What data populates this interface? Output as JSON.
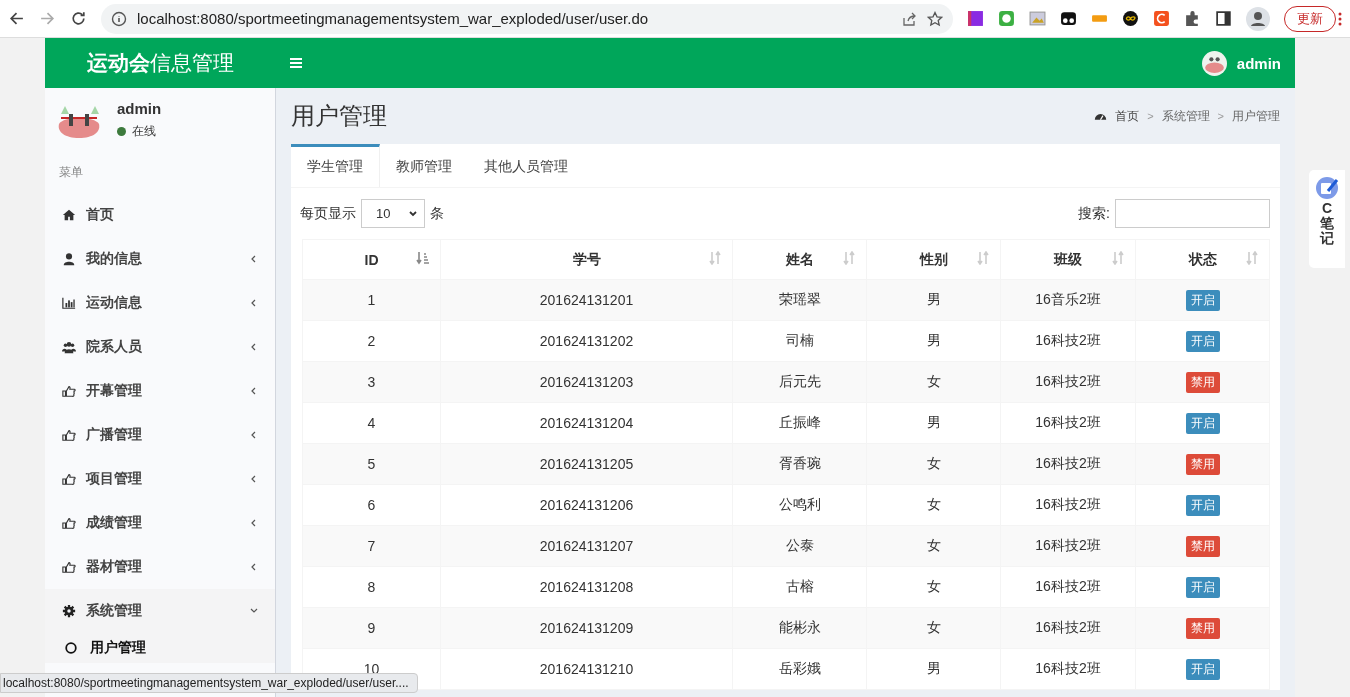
{
  "browser": {
    "url": "localhost:8080/sportmeetingmanagementsystem_war_exploded/user/user.do",
    "update_button": "更新",
    "status_url": "localhost:8080/sportmeetingmanagementsystem_war_exploded/user/user...."
  },
  "header": {
    "logo_bold": "运动会",
    "logo_rest": "信息管理",
    "user": "admin"
  },
  "sidebar": {
    "user": "admin",
    "status": "在线",
    "online": true,
    "menu_label": "菜单",
    "items": [
      {
        "label": "首页",
        "kind": "home",
        "has_children": false
      },
      {
        "label": "我的信息",
        "kind": "user",
        "has_children": true,
        "expanded": false
      },
      {
        "label": "运动信息",
        "kind": "chart",
        "has_children": true,
        "expanded": false
      },
      {
        "label": "院系人员",
        "kind": "users",
        "has_children": true,
        "expanded": false
      },
      {
        "label": "开幕管理",
        "kind": "hand",
        "has_children": true,
        "expanded": false
      },
      {
        "label": "广播管理",
        "kind": "hand",
        "has_children": true,
        "expanded": false
      },
      {
        "label": "项目管理",
        "kind": "hand",
        "has_children": true,
        "expanded": false
      },
      {
        "label": "成绩管理",
        "kind": "hand",
        "has_children": true,
        "expanded": false
      },
      {
        "label": "器材管理",
        "kind": "hand",
        "has_children": true,
        "expanded": false
      },
      {
        "label": "系统管理",
        "kind": "gear",
        "has_children": true,
        "expanded": true,
        "children": [
          {
            "label": "用户管理",
            "selected": true
          }
        ]
      }
    ]
  },
  "page": {
    "title": "用户管理",
    "breadcrumb": [
      "首页",
      "系统管理",
      "用户管理"
    ],
    "breadcrumb_separator": ">"
  },
  "tabs": [
    {
      "label": "学生管理",
      "selected": true
    },
    {
      "label": "教师管理",
      "selected": false
    },
    {
      "label": "其他人员管理",
      "selected": false
    }
  ],
  "length_control": {
    "before": "每页显示",
    "value": "10",
    "after": "条"
  },
  "search": {
    "label": "搜索:"
  },
  "table": {
    "columns": [
      {
        "label": "ID",
        "sorted": true
      },
      {
        "label": "学号",
        "sorted": false
      },
      {
        "label": "姓名",
        "sorted": false
      },
      {
        "label": "性别",
        "sorted": false
      },
      {
        "label": "班级",
        "sorted": false
      },
      {
        "label": "状态",
        "sorted": false
      }
    ],
    "rows": [
      {
        "id": "1",
        "number": "201624131201",
        "name": "荣瑶翠",
        "gender": "男",
        "class": "16音乐2班",
        "status": "开启",
        "kind": "enabled"
      },
      {
        "id": "2",
        "number": "201624131202",
        "name": "司楠",
        "gender": "男",
        "class": "16科技2班",
        "status": "开启",
        "kind": "enabled"
      },
      {
        "id": "3",
        "number": "201624131203",
        "name": "后元先",
        "gender": "女",
        "class": "16科技2班",
        "status": "禁用",
        "kind": "disabled"
      },
      {
        "id": "4",
        "number": "201624131204",
        "name": "丘振峰",
        "gender": "男",
        "class": "16科技2班",
        "status": "开启",
        "kind": "enabled"
      },
      {
        "id": "5",
        "number": "201624131205",
        "name": "胥香琬",
        "gender": "女",
        "class": "16科技2班",
        "status": "禁用",
        "kind": "disabled"
      },
      {
        "id": "6",
        "number": "201624131206",
        "name": "公鸣利",
        "gender": "女",
        "class": "16科技2班",
        "status": "开启",
        "kind": "enabled"
      },
      {
        "id": "7",
        "number": "201624131207",
        "name": "公泰",
        "gender": "女",
        "class": "16科技2班",
        "status": "禁用",
        "kind": "disabled"
      },
      {
        "id": "8",
        "number": "201624131208",
        "name": "古榕",
        "gender": "女",
        "class": "16科技2班",
        "status": "开启",
        "kind": "enabled"
      },
      {
        "id": "9",
        "number": "201624131209",
        "name": "能彬永",
        "gender": "女",
        "class": "16科技2班",
        "status": "禁用",
        "kind": "disabled"
      },
      {
        "id": "10",
        "number": "201624131210",
        "name": "岳彩娥",
        "gender": "男",
        "class": "16科技2班",
        "status": "开启",
        "kind": "enabled"
      }
    ]
  },
  "side_widget": {
    "letter": "C",
    "label": "笔记"
  }
}
